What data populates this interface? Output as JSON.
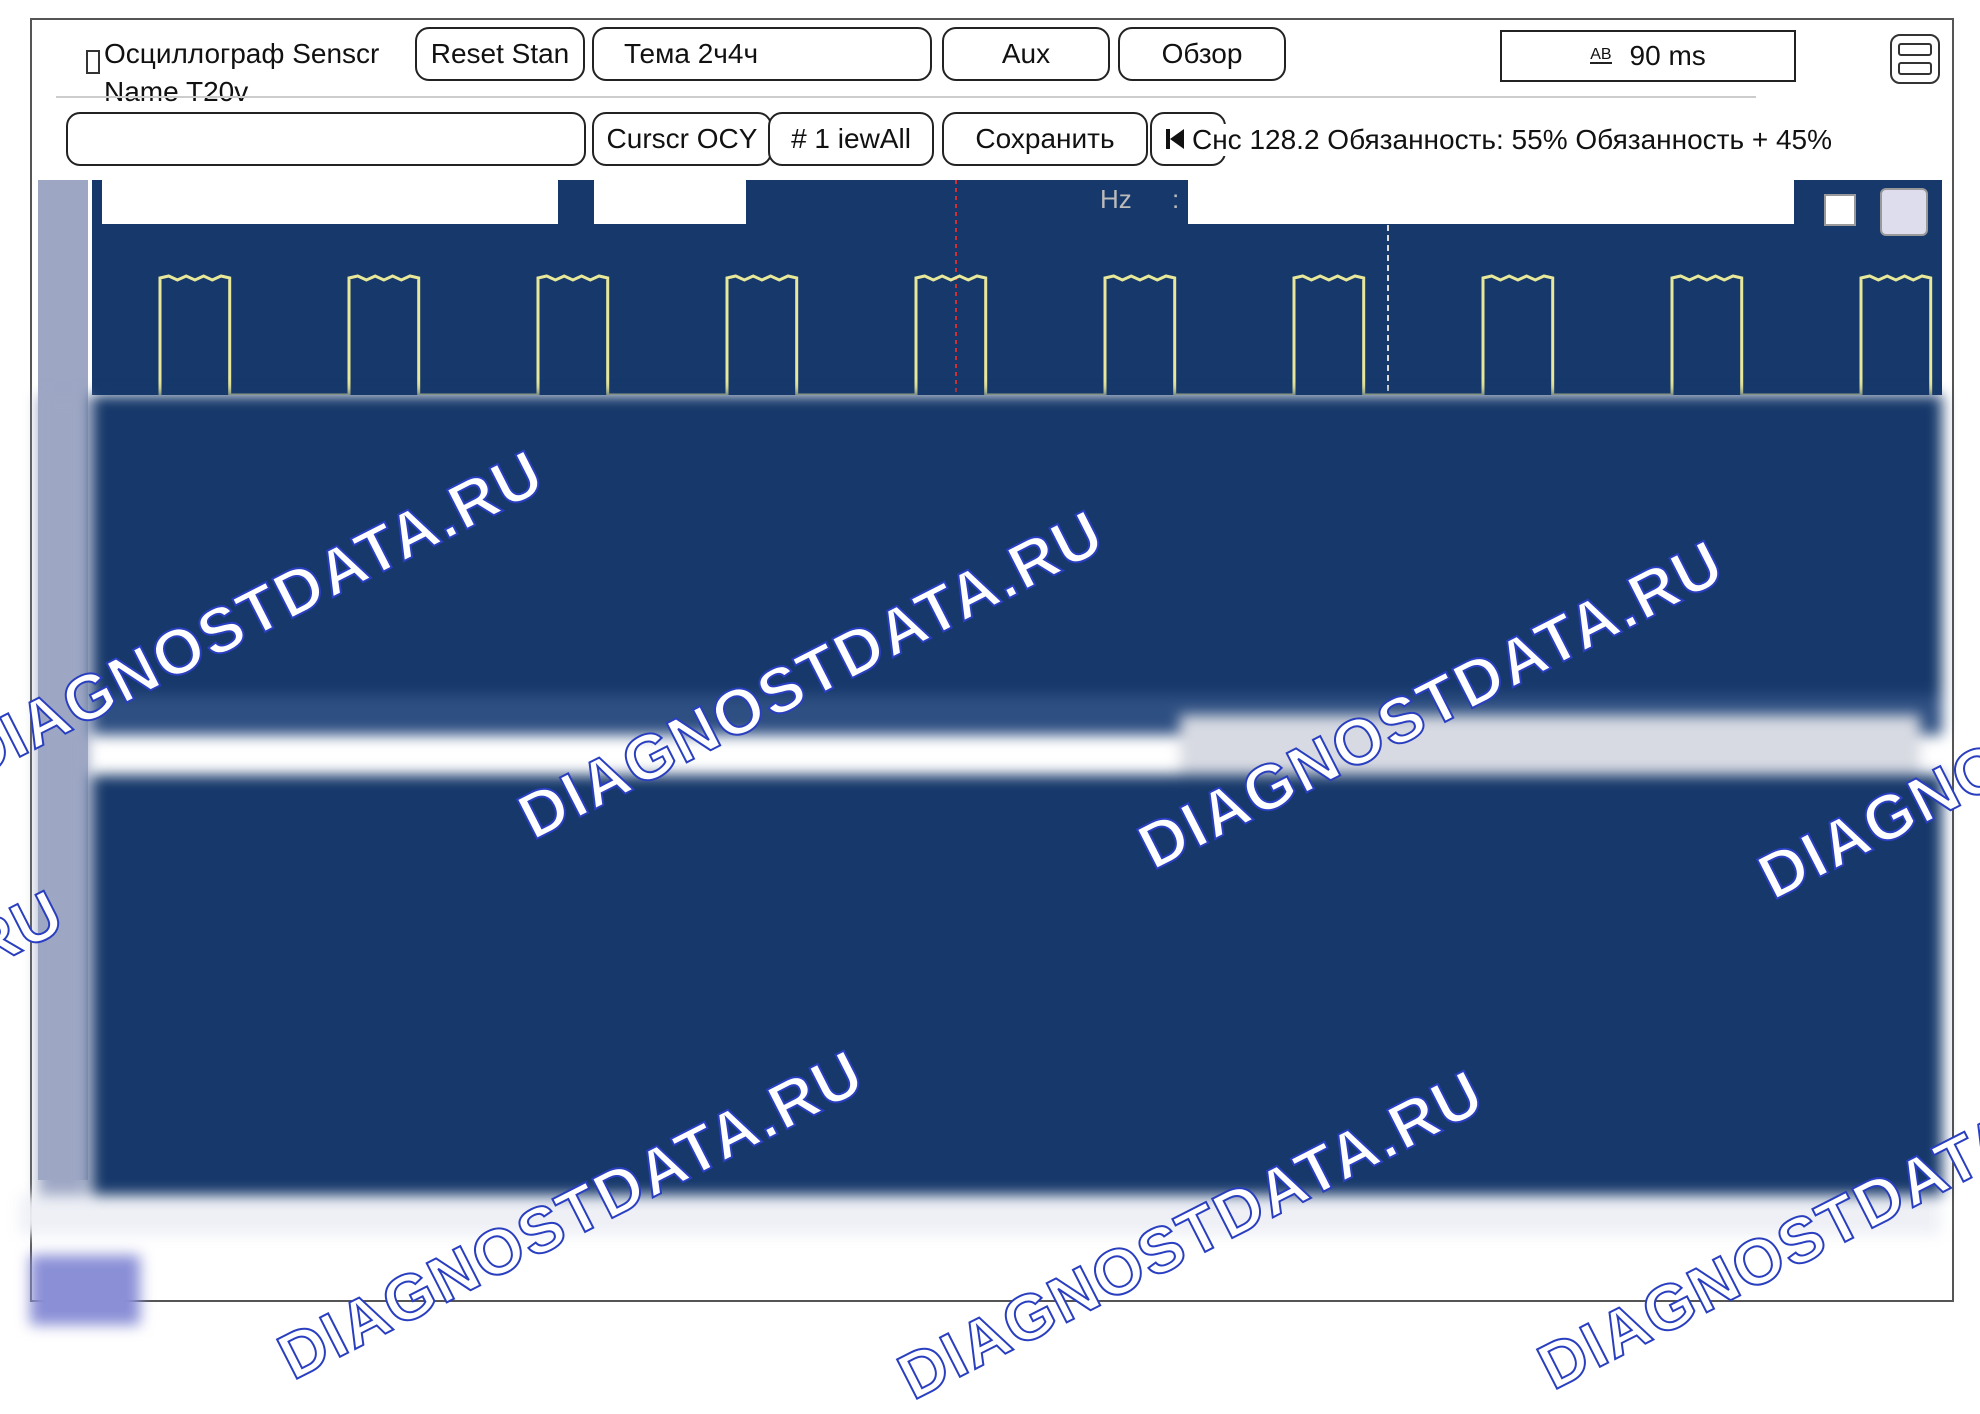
{
  "title": "Осциллограф Senscr",
  "name_label": "Name T20v",
  "toolbar_row1": {
    "reset_label": "Reset Stan",
    "theme_label": "Тема 2ч4ч",
    "aux_label": "Aux",
    "overview_label": "Обзор",
    "timebase_icon": "AB",
    "timebase_value": "90 ms"
  },
  "toolbar_row2": {
    "cursor_label": "Curscr OCY",
    "viewall_label": "# 1 iewAll",
    "save_label": "Сохранить",
    "nav_start_icon": "skip-start-icon",
    "measurements": "Снс 128.2 Обязанность: 55% Обязанность + 45%"
  },
  "scope": {
    "hz_label": "Hz",
    "colon": ":",
    "trace_color": "#e8e89a",
    "background_color": "#16386a",
    "cursor_red_color": "#d03030",
    "pulse_count": 10,
    "duty_cycle_percent": 45
  },
  "watermark": "DIAGNOSTDATA.RU"
}
